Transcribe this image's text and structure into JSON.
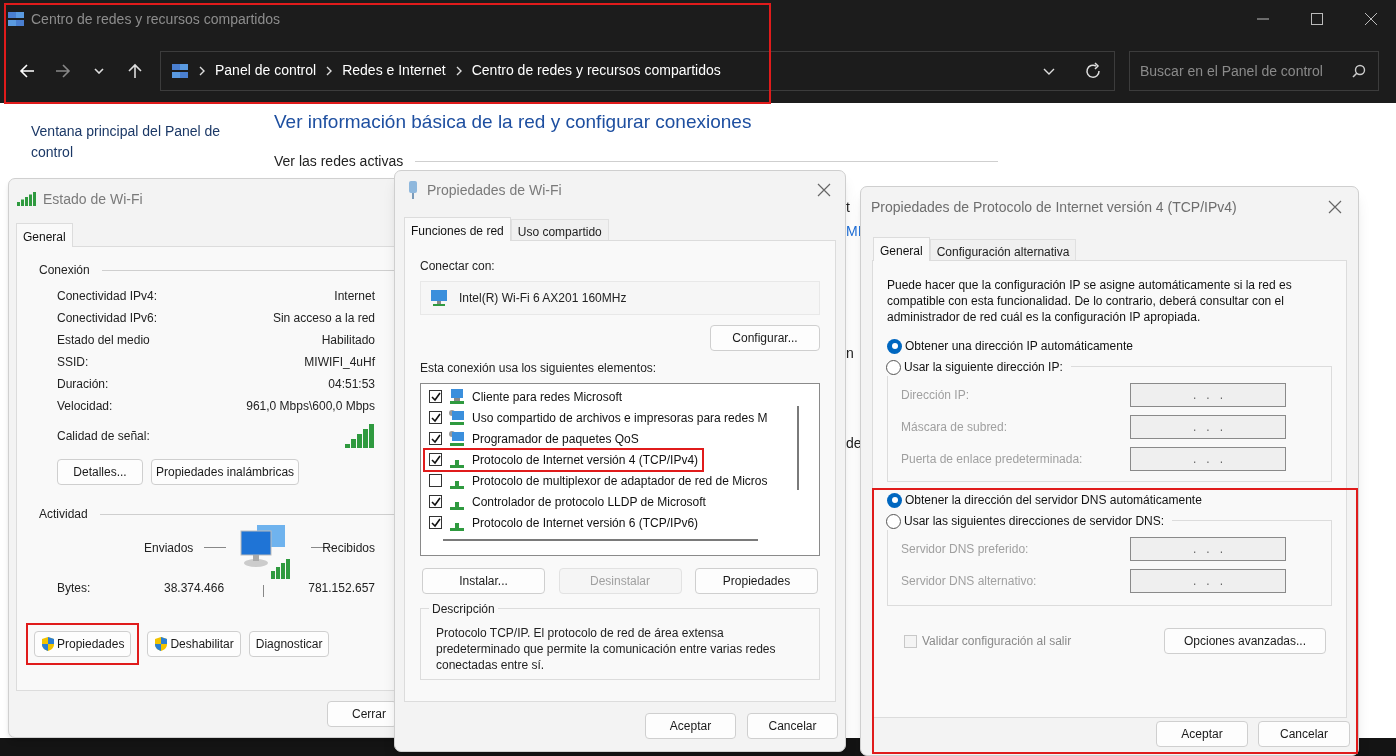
{
  "explorer": {
    "title": "Centro de redes y recursos compartidos",
    "highlighted": true,
    "breadcrumb": [
      "Panel de control",
      "Redes e Internet",
      "Centro de redes y recursos compartidos"
    ],
    "search": {
      "placeholder": "Buscar en el Panel de control"
    }
  },
  "page": {
    "sidebar_link": "Ventana principal del Panel de control",
    "heading": "Ver información básica de la red y configurar conexiones",
    "section": "Ver las redes activas",
    "fragments": [
      {
        "text": "t",
        "kind": "text"
      },
      {
        "text": "MI",
        "kind": "link"
      },
      {
        "text": "n",
        "kind": "text"
      },
      {
        "text": "de",
        "kind": "text"
      }
    ]
  },
  "wifi_status": {
    "title": "Estado de Wi-Fi",
    "tabs": [
      {
        "label": "General",
        "selected": true
      }
    ],
    "connection_label": "Conexión",
    "rows": [
      {
        "label": "Conectividad IPv4:",
        "value": "Internet"
      },
      {
        "label": "Conectividad IPv6:",
        "value": "Sin acceso a la red"
      },
      {
        "label": "Estado del medio",
        "value": "Habilitado"
      },
      {
        "label": "SSID:",
        "value": "MIWIFI_4uHf"
      },
      {
        "label": "Duración:",
        "value": "04:51:53"
      },
      {
        "label": "Velocidad:",
        "value": "961,0 Mbps\\600,0 Mbps"
      }
    ],
    "signal_label": "Calidad de señal:",
    "buttons": [
      "Detalles...",
      "Propiedades inalámbricas"
    ],
    "activity_label": "Actividad",
    "sent_label": "Enviados",
    "received_label": "Recibidos",
    "bytes_label": "Bytes:",
    "bytes_sent": "38.374.466",
    "bytes_received": "781.152.657",
    "actions": [
      {
        "label": "Propiedades",
        "shield": true,
        "highlighted": true
      },
      {
        "label": "Deshabilitar",
        "shield": true,
        "highlighted": false
      },
      {
        "label": "Diagnosticar",
        "shield": false,
        "highlighted": false
      }
    ],
    "close_button": "Cerrar"
  },
  "wifi_properties": {
    "title": "Propiedades de Wi-Fi",
    "tabs": [
      {
        "label": "Funciones de red",
        "selected": true
      },
      {
        "label": "Uso compartido",
        "selected": false
      }
    ],
    "connect_label": "Conectar con:",
    "adapter": "Intel(R) Wi-Fi 6 AX201 160MHz",
    "configure_button": "Configurar...",
    "items_label": "Esta conexión usa los siguientes elementos:",
    "items": [
      {
        "label": "Cliente para redes Microsoft",
        "kind": "client",
        "checked": true,
        "highlighted": false
      },
      {
        "label": "Uso compartido de archivos e impresoras para redes M",
        "kind": "service",
        "checked": true,
        "highlighted": false
      },
      {
        "label": "Programador de paquetes QoS",
        "kind": "service",
        "checked": true,
        "highlighted": false
      },
      {
        "label": "Protocolo de Internet versión 4 (TCP/IPv4)",
        "kind": "protocol",
        "checked": true,
        "highlighted": true
      },
      {
        "label": "Protocolo de multiplexor de adaptador de red de Micros",
        "kind": "protocol",
        "checked": false,
        "highlighted": false
      },
      {
        "label": "Controlador de protocolo LLDP de Microsoft",
        "kind": "protocol",
        "checked": true,
        "highlighted": false
      },
      {
        "label": "Protocolo de Internet versión 6 (TCP/IPv6)",
        "kind": "protocol",
        "checked": true,
        "highlighted": false
      }
    ],
    "buttons": [
      {
        "label": "Instalar...",
        "disabled": false
      },
      {
        "label": "Desinstalar",
        "disabled": true
      },
      {
        "label": "Propiedades",
        "disabled": false
      }
    ],
    "description_label": "Descripción",
    "description": "Protocolo TCP/IP. El protocolo de red de área extensa predeterminado que permite la comunicación entre varias redes conectadas entre sí.",
    "footer": [
      "Aceptar",
      "Cancelar"
    ]
  },
  "ipv4": {
    "title": "Propiedades de Protocolo de Internet versión 4 (TCP/IPv4)",
    "tabs": [
      {
        "label": "General",
        "selected": true
      },
      {
        "label": "Configuración alternativa",
        "selected": false
      }
    ],
    "intro": "Puede hacer que la configuración IP se asigne automáticamente si la red es compatible con esta funcionalidad. De lo contrario, deberá consultar con el administrador de red cuál es la configuración IP apropiada.",
    "ip_options": [
      {
        "label": "Obtener una dirección IP automáticamente",
        "selected": true
      },
      {
        "label": "Usar la siguiente dirección IP:",
        "selected": false
      }
    ],
    "ip_fields": [
      {
        "label": "Dirección IP:",
        "value": ".   .   .",
        "disabled": true
      },
      {
        "label": "Máscara de subred:",
        "value": ".   .   .",
        "disabled": true
      },
      {
        "label": "Puerta de enlace predeterminada:",
        "value": ".   .   .",
        "disabled": true
      }
    ],
    "dns_highlighted": true,
    "dns_options": [
      {
        "label": "Obtener la dirección del servidor DNS automáticamente",
        "selected": true
      },
      {
        "label": "Usar las siguientes direcciones de servidor DNS:",
        "selected": false
      }
    ],
    "dns_fields": [
      {
        "label": "Servidor DNS preferido:",
        "value": ".   .   .",
        "disabled": true
      },
      {
        "label": "Servidor DNS alternativo:",
        "value": ".   .   .",
        "disabled": true
      }
    ],
    "validate": {
      "label": "Validar configuración al salir",
      "checked": false,
      "disabled": true
    },
    "advanced_button": "Opciones avanzadas...",
    "footer": [
      "Aceptar",
      "Cancelar"
    ]
  }
}
